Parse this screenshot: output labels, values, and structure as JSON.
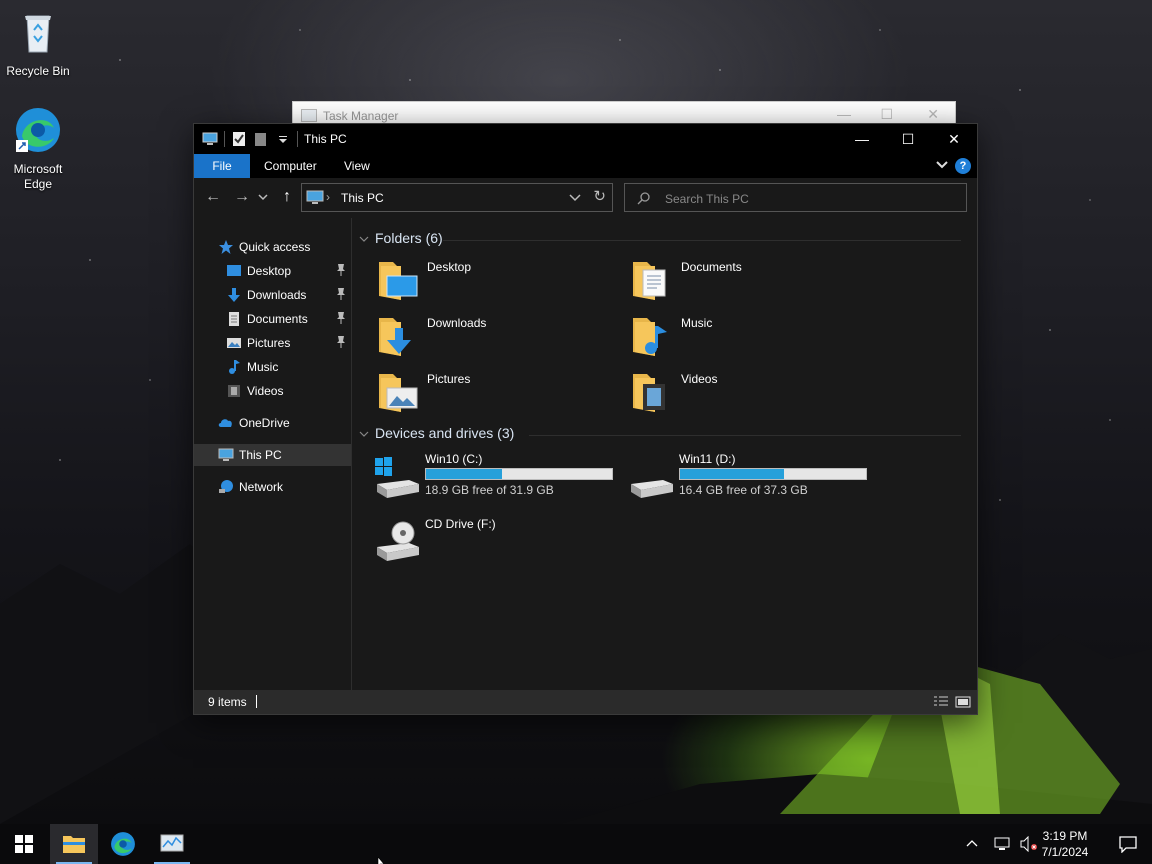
{
  "desktop": {
    "icons": [
      {
        "label": "Recycle Bin",
        "icon": "recycle-bin-icon"
      },
      {
        "label": "Microsoft\nEdge",
        "icon": "edge-icon"
      }
    ]
  },
  "task_manager": {
    "title": "Task Manager"
  },
  "explorer": {
    "title": "This PC",
    "ribbon_tabs": [
      "File",
      "Computer",
      "View"
    ],
    "help_label": "?",
    "address": {
      "crumb": "This PC"
    },
    "search": {
      "placeholder": "Search This PC"
    },
    "nav": {
      "quick_access": "Quick access",
      "quick_items": [
        "Desktop",
        "Downloads",
        "Documents",
        "Pictures",
        "Music",
        "Videos"
      ],
      "onedrive": "OneDrive",
      "this_pc": "This PC",
      "network": "Network"
    },
    "folders_header": "Folders (6)",
    "folders": [
      "Desktop",
      "Documents",
      "Downloads",
      "Music",
      "Pictures",
      "Videos"
    ],
    "drives_header": "Devices and drives (3)",
    "drives": [
      {
        "name": "Win10 (C:)",
        "free": "18.9 GB free of 31.9 GB",
        "used_fraction": 0.41
      },
      {
        "name": "Win11 (D:)",
        "free": "16.4 GB free of 37.3 GB",
        "used_fraction": 0.56
      },
      {
        "name": "CD Drive (F:)"
      }
    ],
    "status": {
      "count": "9 items"
    }
  },
  "taskbar": {
    "clock_time": "3:19 PM",
    "clock_date": "7/1/2024"
  },
  "colors": {
    "accent": "#1a73c9",
    "drive_bar": "#26a0da",
    "folder": "#f6c65b"
  }
}
